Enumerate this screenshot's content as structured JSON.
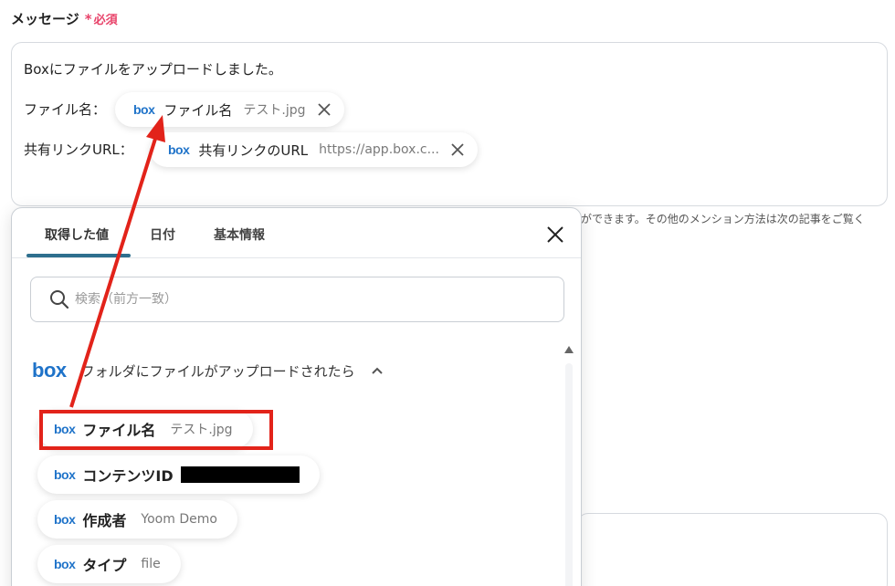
{
  "form": {
    "label": "メッセージ",
    "required_star": "*",
    "required_text": "必須",
    "message": {
      "line1": "Boxにファイルをアップロードしました。",
      "line2_label": "ファイル名：",
      "line3_label": "共有リンクURL：",
      "chips": [
        {
          "logo": "box",
          "name": "ファイル名",
          "value": "テスト.jpg"
        },
        {
          "logo": "box",
          "name": "共有リンクのURL",
          "value": "https://app.box.c..."
        }
      ]
    },
    "hint": "ができます。その他のメンション方法は次の記事をご覧く"
  },
  "picker": {
    "tabs": [
      {
        "label": "取得した値",
        "active": true
      },
      {
        "label": "日付",
        "active": false
      },
      {
        "label": "基本情報",
        "active": false
      }
    ],
    "search_placeholder": "検索（前方一致）",
    "section": {
      "logo": "box",
      "title": "フォルダにファイルがアップロードされたら"
    },
    "items": [
      {
        "logo": "box",
        "name": "ファイル名",
        "value": "テスト.jpg"
      },
      {
        "logo": "box",
        "name": "コンテンツID",
        "value": ""
      },
      {
        "logo": "box",
        "name": "作成者",
        "value": "Yoom Demo"
      },
      {
        "logo": "box",
        "name": "タイプ",
        "value": "file"
      }
    ]
  },
  "colors": {
    "required": "#e8436a",
    "box_brand": "#1f73c9",
    "tab_active": "#2e6f8e",
    "annotation": "#e2231a"
  }
}
